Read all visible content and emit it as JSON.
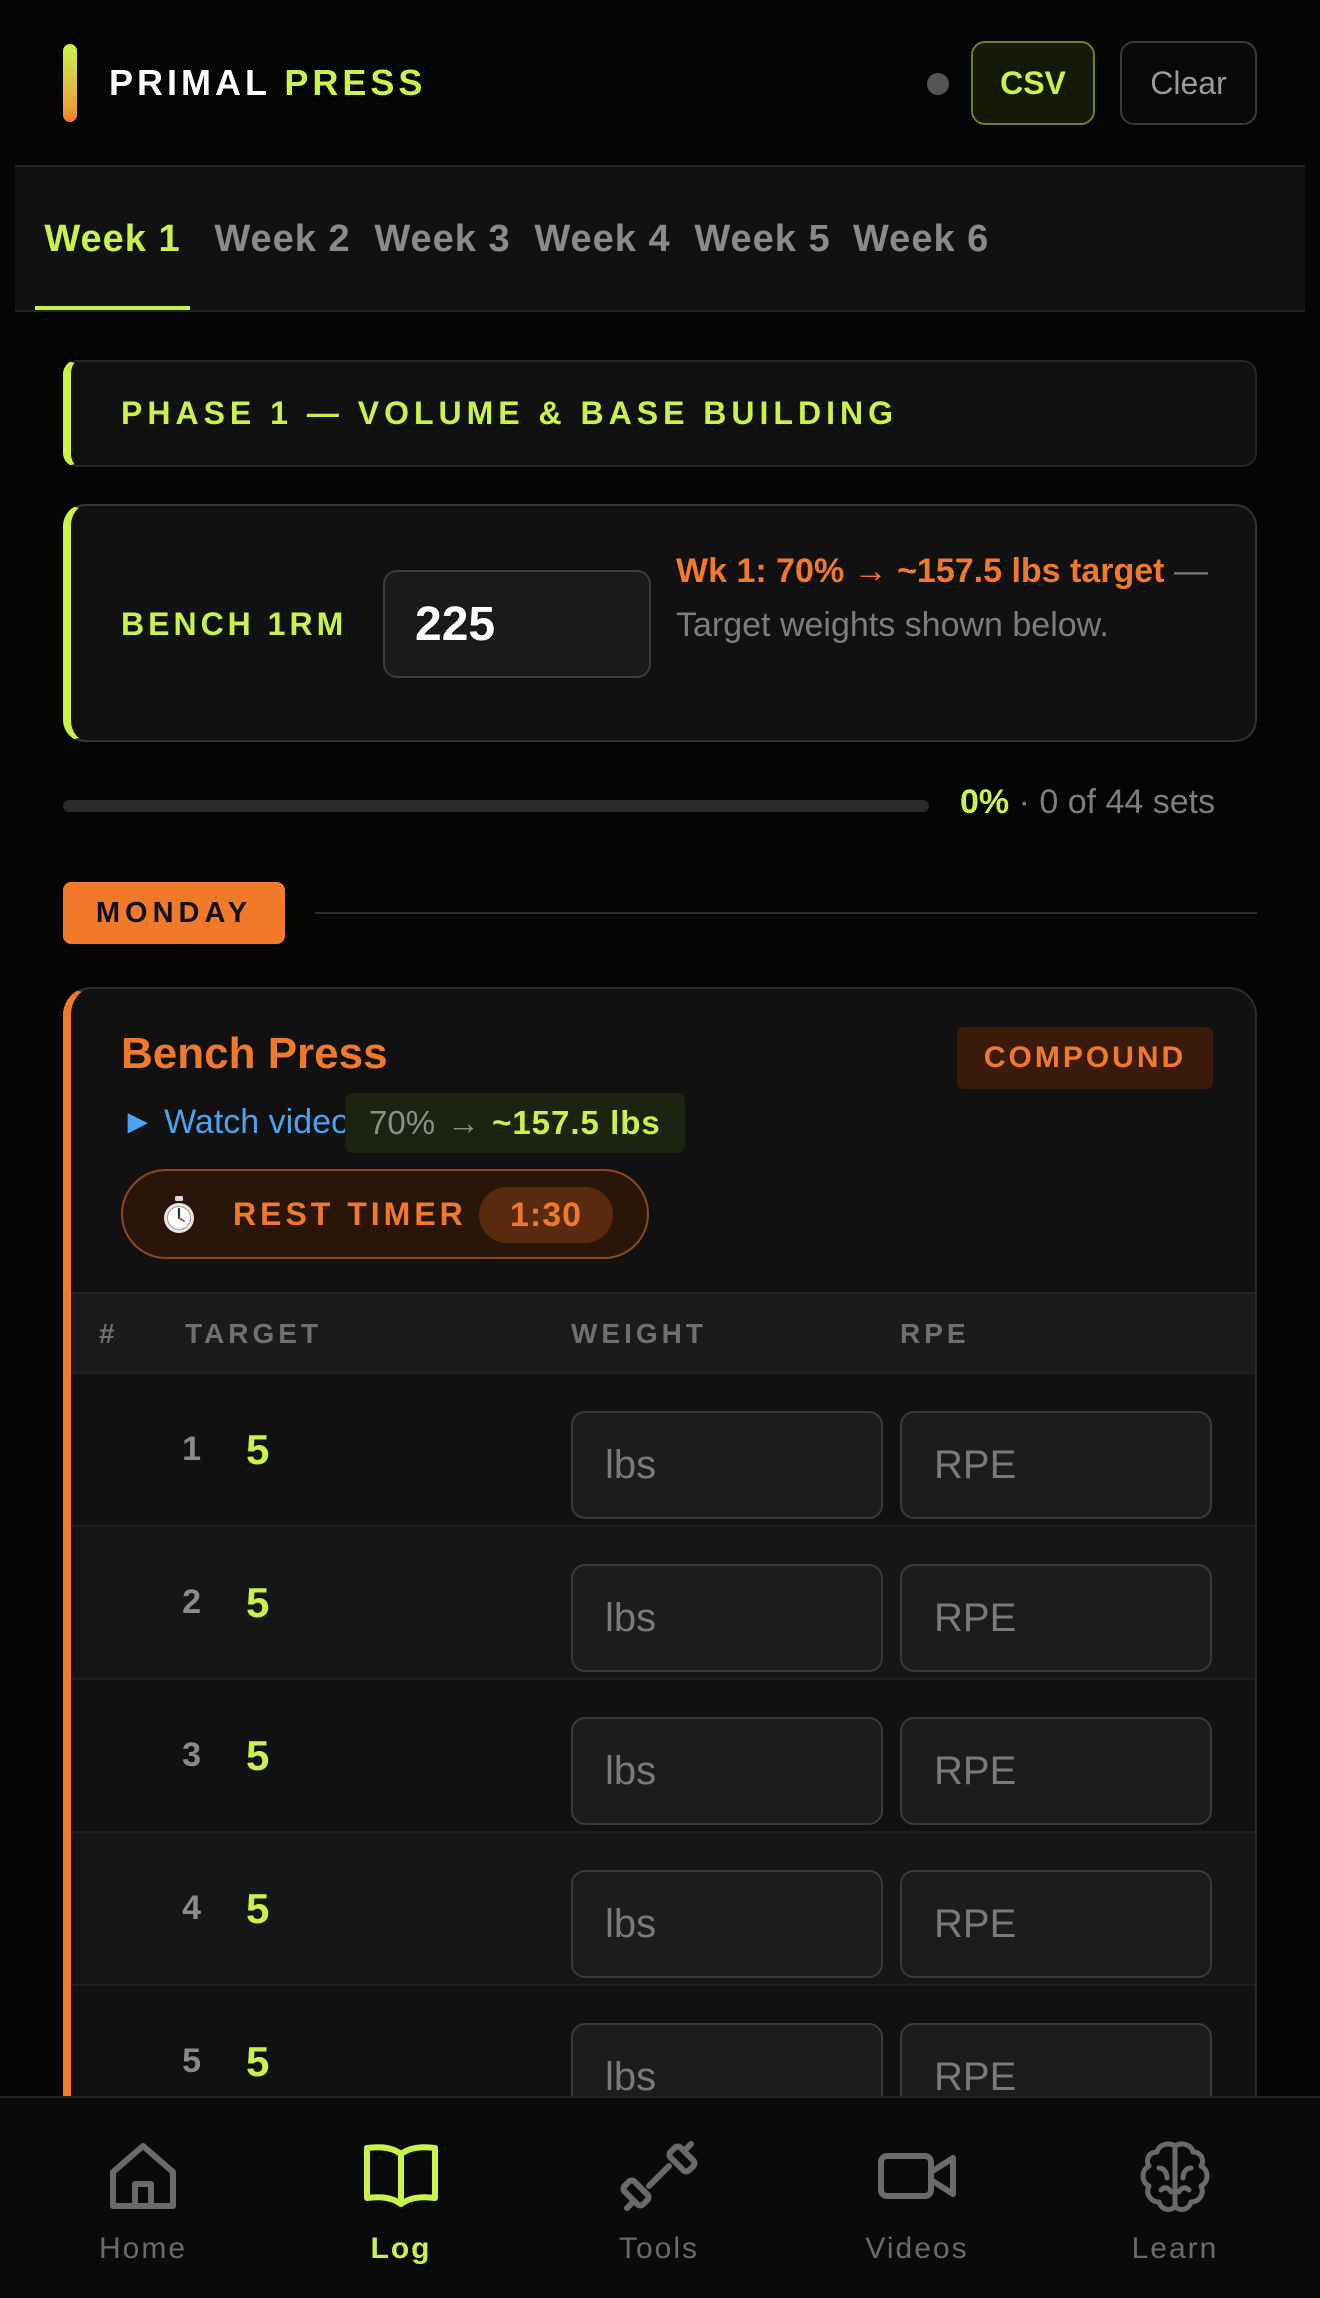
{
  "header": {
    "brand_word1": "PRIMAL",
    "brand_word2": "PRESS",
    "csv_label": "CSV",
    "clear_label": "Clear"
  },
  "tabs": [
    {
      "label": "Week 1",
      "active": true
    },
    {
      "label": "Week 2",
      "active": false
    },
    {
      "label": "Week 3",
      "active": false
    },
    {
      "label": "Week 4",
      "active": false
    },
    {
      "label": "Week 5",
      "active": false
    },
    {
      "label": "Week 6",
      "active": false
    }
  ],
  "phase": {
    "title": "PHASE 1 — VOLUME & BASE BUILDING"
  },
  "one_rm": {
    "label": "BENCH 1RM",
    "value": "225",
    "note_highlight_1": "Wk 1: 70% → ~157.5 lbs",
    "note_highlight_2": "target",
    "note_rest": " — Target weights shown below."
  },
  "progress": {
    "percent": "0%",
    "fraction": 0,
    "detail": " · 0 of 44 sets"
  },
  "day": {
    "label": "MONDAY"
  },
  "exercise": {
    "name": "Bench Press",
    "tag": "COMPOUND",
    "video_link": "► Watch video",
    "intensity_pct": "70%",
    "arrow": "→",
    "target_weight": "~157.5 lbs",
    "rest_timer_label": "REST TIMER",
    "rest_timer_value": "1:30",
    "columns": {
      "num": "#",
      "target": "TARGET",
      "weight": "WEIGHT",
      "rpe": "RPE"
    },
    "sets": [
      {
        "num": "1",
        "target": "5",
        "weight_placeholder": "lbs",
        "rpe_placeholder": "RPE"
      },
      {
        "num": "2",
        "target": "5",
        "weight_placeholder": "lbs",
        "rpe_placeholder": "RPE"
      },
      {
        "num": "3",
        "target": "5",
        "weight_placeholder": "lbs",
        "rpe_placeholder": "RPE"
      },
      {
        "num": "4",
        "target": "5",
        "weight_placeholder": "lbs",
        "rpe_placeholder": "RPE"
      },
      {
        "num": "5",
        "target": "5",
        "weight_placeholder": "lbs",
        "rpe_placeholder": "RPE"
      }
    ]
  },
  "nav": [
    {
      "label": "Home",
      "icon": "home-icon",
      "active": false
    },
    {
      "label": "Log",
      "icon": "book-icon",
      "active": true
    },
    {
      "label": "Tools",
      "icon": "dumbbell-icon",
      "active": false
    },
    {
      "label": "Videos",
      "icon": "video-camera-icon",
      "active": false
    },
    {
      "label": "Learn",
      "icon": "brain-icon",
      "active": false
    }
  ],
  "colors": {
    "accent_lime": "#c9f34a",
    "accent_orange": "#f07a2a",
    "link_blue": "#4aa3f0",
    "background": "#050505"
  }
}
